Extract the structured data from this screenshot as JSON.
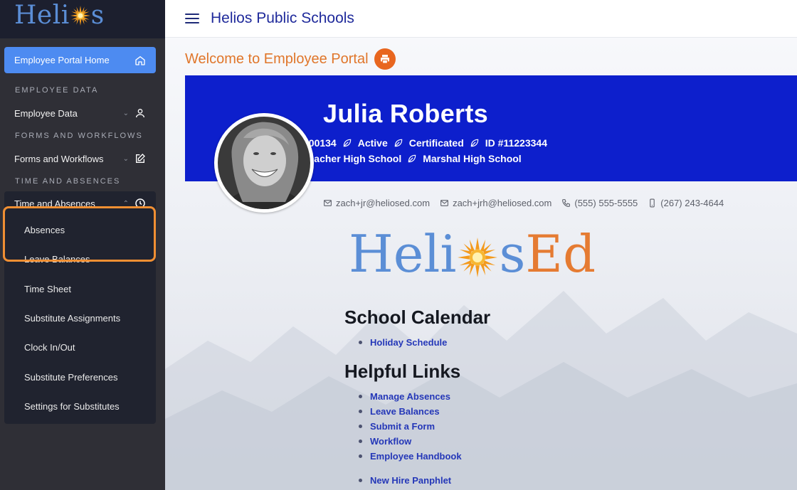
{
  "brand": {
    "prefix": "Heli",
    "suffix": "s"
  },
  "sidebar": {
    "home_label": "Employee Portal Home",
    "sections": {
      "employee_data": "EMPLOYEE DATA",
      "forms": "FORMS AND WORKFLOWS",
      "time": "TIME AND ABSENCES"
    },
    "employee_data_item": "Employee Data",
    "forms_item": "Forms and Workflows",
    "time_item": "Time and Absences",
    "sub_items": [
      "Absences",
      "Leave Balances",
      "Time Sheet",
      "Substitute Assignments",
      "Clock In/Out",
      "Substitute Preferences",
      "Settings for Substitutes"
    ]
  },
  "topbar": {
    "title": "Helios Public Schools"
  },
  "welcome": {
    "title": "Welcome to Employee Portal"
  },
  "employee": {
    "name": "Julia Roberts",
    "number": "100134",
    "status": "Active",
    "type": "Certificated",
    "id": "ID #11223344",
    "position": "Teacher High School",
    "school": "Marshal High School",
    "email1": "zach+jr@heliosed.com",
    "email2": "zach+jrh@heliosed.com",
    "phone1": "(555) 555-5555",
    "phone2": "(267) 243-4644"
  },
  "logo": {
    "part1": "Heli",
    "part2": "s",
    "part3": "Ed"
  },
  "calendar": {
    "heading": "School Calendar",
    "links": [
      "Holiday Schedule"
    ]
  },
  "helpful": {
    "heading": "Helpful Links",
    "links": [
      "Manage Absences",
      "Leave Balances",
      "Submit a Form",
      "Workflow",
      "Employee Handbook"
    ],
    "extra": [
      "New Hire Panphlet"
    ]
  },
  "colors": {
    "sidebar_bg": "#2f2f36",
    "accent_blue": "#4d8bf1",
    "banner_blue": "#0d1fcc",
    "orange": "#e0762a",
    "highlight": "#f08f33"
  }
}
